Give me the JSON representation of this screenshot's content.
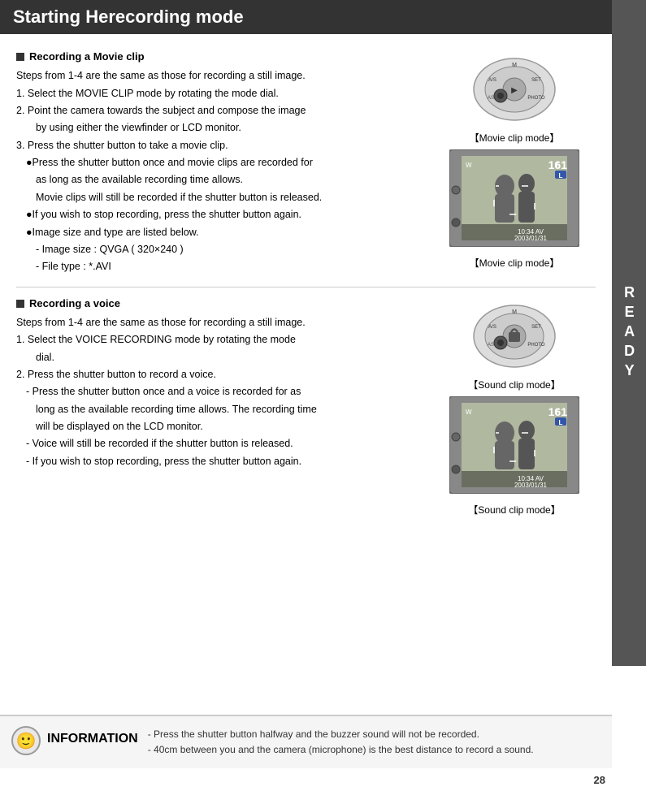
{
  "header": {
    "title": "Starting Herecording mode"
  },
  "sidebar": {
    "letters": [
      "R",
      "E",
      "A",
      "D",
      "Y"
    ]
  },
  "section1": {
    "heading": "Recording a Movie clip",
    "steps": [
      "Steps from 1-4 are the same as those for recording a still image.",
      "1. Select the MOVIE CLIP mode by rotating the mode dial.",
      "2. Point the camera towards the subject and compose the image",
      "   by using either the viewfinder or LCD monitor.",
      "3. Press the shutter button to take a movie clip.",
      "●Press the shutter button once and movie clips are recorded for",
      "  as long as the available recording time allows.",
      "  Movie clips will still be recorded if the shutter button is released.",
      "●If you wish to stop recording, press the shutter button again.",
      "●Image size and type are listed below.",
      " - Image size : QVGA ( 320×240 )",
      " - File type : *.AVI"
    ],
    "dial_label": "【Movie clip mode】",
    "lcd_label": "【Movie clip mode】"
  },
  "section2": {
    "heading": "Recording a voice",
    "steps": [
      "Steps from 1-4 are the same as those for recording a still image.",
      "1. Select the VOICE RECORDING mode by rotating the mode",
      "   dial.",
      "2. Press the shutter button to record a voice.",
      " - Press the shutter button once and a voice is recorded for as",
      "   long as the available recording time allows. The recording time",
      "   will be displayed on the LCD monitor.",
      " - Voice will still be recorded if the shutter button is released.",
      " - If you wish to stop recording, press the shutter button again."
    ],
    "dial_label": "【Sound clip mode】",
    "lcd_label": "【Sound clip mode】"
  },
  "info": {
    "label": "INFORMATION",
    "lines": [
      "- Press the shutter button halfway and the buzzer sound will not be recorded.",
      "- 40cm between you and the camera (microphone) is the best distance to record a sound."
    ]
  },
  "page_number": "28",
  "lcd_data": {
    "number": "161",
    "time": "10:34 AV",
    "date": "2003/01/31"
  }
}
